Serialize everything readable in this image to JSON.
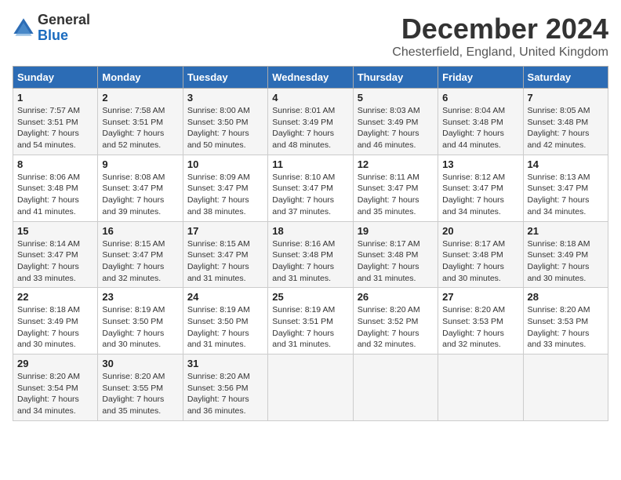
{
  "logo": {
    "general": "General",
    "blue": "Blue"
  },
  "title": "December 2024",
  "subtitle": "Chesterfield, England, United Kingdom",
  "days_of_week": [
    "Sunday",
    "Monday",
    "Tuesday",
    "Wednesday",
    "Thursday",
    "Friday",
    "Saturday"
  ],
  "weeks": [
    [
      {
        "day": "1",
        "sunrise": "Sunrise: 7:57 AM",
        "sunset": "Sunset: 3:51 PM",
        "daylight": "Daylight: 7 hours and 54 minutes."
      },
      {
        "day": "2",
        "sunrise": "Sunrise: 7:58 AM",
        "sunset": "Sunset: 3:51 PM",
        "daylight": "Daylight: 7 hours and 52 minutes."
      },
      {
        "day": "3",
        "sunrise": "Sunrise: 8:00 AM",
        "sunset": "Sunset: 3:50 PM",
        "daylight": "Daylight: 7 hours and 50 minutes."
      },
      {
        "day": "4",
        "sunrise": "Sunrise: 8:01 AM",
        "sunset": "Sunset: 3:49 PM",
        "daylight": "Daylight: 7 hours and 48 minutes."
      },
      {
        "day": "5",
        "sunrise": "Sunrise: 8:03 AM",
        "sunset": "Sunset: 3:49 PM",
        "daylight": "Daylight: 7 hours and 46 minutes."
      },
      {
        "day": "6",
        "sunrise": "Sunrise: 8:04 AM",
        "sunset": "Sunset: 3:48 PM",
        "daylight": "Daylight: 7 hours and 44 minutes."
      },
      {
        "day": "7",
        "sunrise": "Sunrise: 8:05 AM",
        "sunset": "Sunset: 3:48 PM",
        "daylight": "Daylight: 7 hours and 42 minutes."
      }
    ],
    [
      {
        "day": "8",
        "sunrise": "Sunrise: 8:06 AM",
        "sunset": "Sunset: 3:48 PM",
        "daylight": "Daylight: 7 hours and 41 minutes."
      },
      {
        "day": "9",
        "sunrise": "Sunrise: 8:08 AM",
        "sunset": "Sunset: 3:47 PM",
        "daylight": "Daylight: 7 hours and 39 minutes."
      },
      {
        "day": "10",
        "sunrise": "Sunrise: 8:09 AM",
        "sunset": "Sunset: 3:47 PM",
        "daylight": "Daylight: 7 hours and 38 minutes."
      },
      {
        "day": "11",
        "sunrise": "Sunrise: 8:10 AM",
        "sunset": "Sunset: 3:47 PM",
        "daylight": "Daylight: 7 hours and 37 minutes."
      },
      {
        "day": "12",
        "sunrise": "Sunrise: 8:11 AM",
        "sunset": "Sunset: 3:47 PM",
        "daylight": "Daylight: 7 hours and 35 minutes."
      },
      {
        "day": "13",
        "sunrise": "Sunrise: 8:12 AM",
        "sunset": "Sunset: 3:47 PM",
        "daylight": "Daylight: 7 hours and 34 minutes."
      },
      {
        "day": "14",
        "sunrise": "Sunrise: 8:13 AM",
        "sunset": "Sunset: 3:47 PM",
        "daylight": "Daylight: 7 hours and 34 minutes."
      }
    ],
    [
      {
        "day": "15",
        "sunrise": "Sunrise: 8:14 AM",
        "sunset": "Sunset: 3:47 PM",
        "daylight": "Daylight: 7 hours and 33 minutes."
      },
      {
        "day": "16",
        "sunrise": "Sunrise: 8:15 AM",
        "sunset": "Sunset: 3:47 PM",
        "daylight": "Daylight: 7 hours and 32 minutes."
      },
      {
        "day": "17",
        "sunrise": "Sunrise: 8:15 AM",
        "sunset": "Sunset: 3:47 PM",
        "daylight": "Daylight: 7 hours and 31 minutes."
      },
      {
        "day": "18",
        "sunrise": "Sunrise: 8:16 AM",
        "sunset": "Sunset: 3:48 PM",
        "daylight": "Daylight: 7 hours and 31 minutes."
      },
      {
        "day": "19",
        "sunrise": "Sunrise: 8:17 AM",
        "sunset": "Sunset: 3:48 PM",
        "daylight": "Daylight: 7 hours and 31 minutes."
      },
      {
        "day": "20",
        "sunrise": "Sunrise: 8:17 AM",
        "sunset": "Sunset: 3:48 PM",
        "daylight": "Daylight: 7 hours and 30 minutes."
      },
      {
        "day": "21",
        "sunrise": "Sunrise: 8:18 AM",
        "sunset": "Sunset: 3:49 PM",
        "daylight": "Daylight: 7 hours and 30 minutes."
      }
    ],
    [
      {
        "day": "22",
        "sunrise": "Sunrise: 8:18 AM",
        "sunset": "Sunset: 3:49 PM",
        "daylight": "Daylight: 7 hours and 30 minutes."
      },
      {
        "day": "23",
        "sunrise": "Sunrise: 8:19 AM",
        "sunset": "Sunset: 3:50 PM",
        "daylight": "Daylight: 7 hours and 30 minutes."
      },
      {
        "day": "24",
        "sunrise": "Sunrise: 8:19 AM",
        "sunset": "Sunset: 3:50 PM",
        "daylight": "Daylight: 7 hours and 31 minutes."
      },
      {
        "day": "25",
        "sunrise": "Sunrise: 8:19 AM",
        "sunset": "Sunset: 3:51 PM",
        "daylight": "Daylight: 7 hours and 31 minutes."
      },
      {
        "day": "26",
        "sunrise": "Sunrise: 8:20 AM",
        "sunset": "Sunset: 3:52 PM",
        "daylight": "Daylight: 7 hours and 32 minutes."
      },
      {
        "day": "27",
        "sunrise": "Sunrise: 8:20 AM",
        "sunset": "Sunset: 3:53 PM",
        "daylight": "Daylight: 7 hours and 32 minutes."
      },
      {
        "day": "28",
        "sunrise": "Sunrise: 8:20 AM",
        "sunset": "Sunset: 3:53 PM",
        "daylight": "Daylight: 7 hours and 33 minutes."
      }
    ],
    [
      {
        "day": "29",
        "sunrise": "Sunrise: 8:20 AM",
        "sunset": "Sunset: 3:54 PM",
        "daylight": "Daylight: 7 hours and 34 minutes."
      },
      {
        "day": "30",
        "sunrise": "Sunrise: 8:20 AM",
        "sunset": "Sunset: 3:55 PM",
        "daylight": "Daylight: 7 hours and 35 minutes."
      },
      {
        "day": "31",
        "sunrise": "Sunrise: 8:20 AM",
        "sunset": "Sunset: 3:56 PM",
        "daylight": "Daylight: 7 hours and 36 minutes."
      },
      null,
      null,
      null,
      null
    ]
  ]
}
